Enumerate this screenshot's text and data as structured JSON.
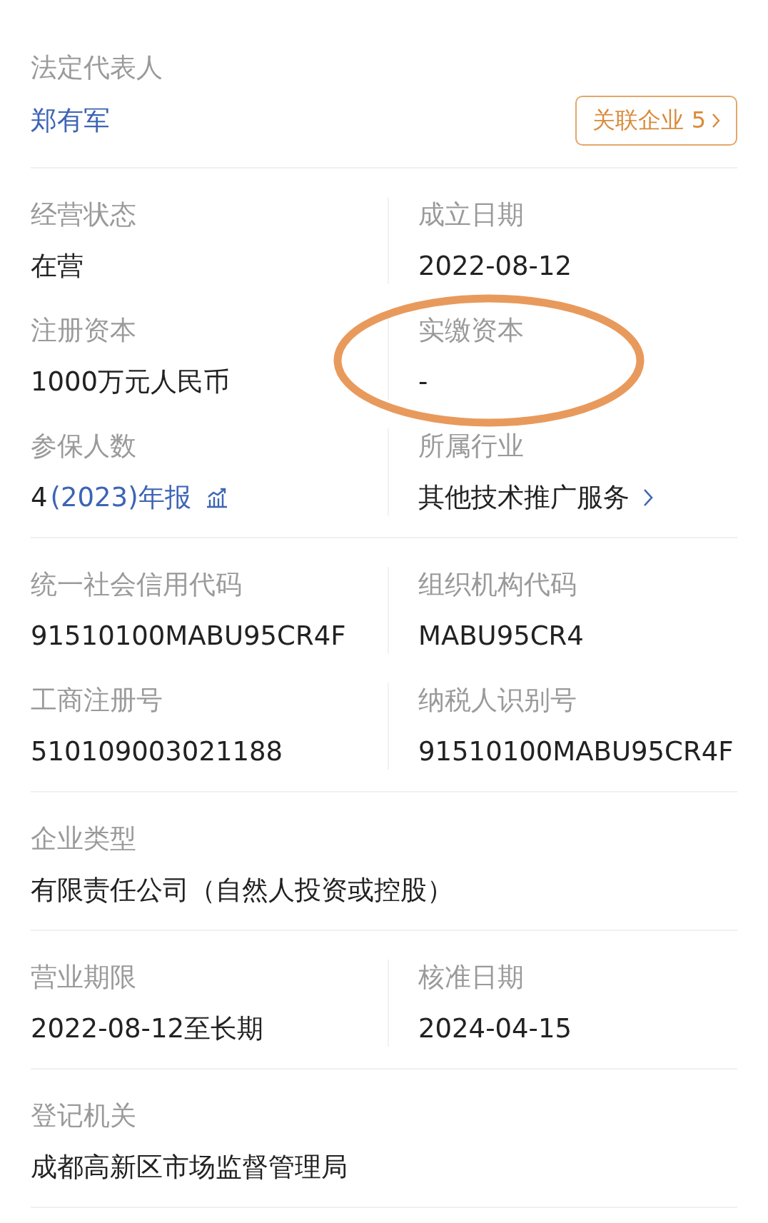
{
  "sections": [
    {
      "rows": [
        [
          {
            "label": "法定代表人",
            "value": "郑有军",
            "link": true,
            "button": "关联企业 5"
          }
        ]
      ]
    },
    {
      "rows": [
        [
          {
            "label": "经营状态",
            "value": "在营"
          },
          {
            "label": "成立日期",
            "value": "2022-08-12"
          }
        ],
        [
          {
            "label": "注册资本",
            "value": "1000万元人民币"
          },
          {
            "label": "实缴资本",
            "value": "-",
            "circled": true
          }
        ],
        [
          {
            "label": "参保人数",
            "value": "4",
            "report": "(2023)年报"
          },
          {
            "label": "所属行业",
            "value": "其他技术推广服务",
            "chevron": true
          }
        ]
      ]
    },
    {
      "rows": [
        [
          {
            "label": "统一社会信用代码",
            "value": "91510100MABU95CR4F"
          },
          {
            "label": "组织机构代码",
            "value": "MABU95CR4"
          }
        ],
        [
          {
            "label": "工商注册号",
            "value": "510109003021188"
          },
          {
            "label": "纳税人识别号",
            "value": "91510100MABU95CR4F"
          }
        ]
      ]
    },
    {
      "rows": [
        [
          {
            "label": "企业类型",
            "value": "有限责任公司（自然人投资或控股）"
          }
        ]
      ]
    },
    {
      "rows": [
        [
          {
            "label": "营业期限",
            "value": "2022-08-12至长期"
          },
          {
            "label": "核准日期",
            "value": "2024-04-15"
          }
        ]
      ]
    },
    {
      "rows": [
        [
          {
            "label": "登记机关",
            "value": "成都高新区市场监督管理局"
          }
        ]
      ]
    }
  ]
}
